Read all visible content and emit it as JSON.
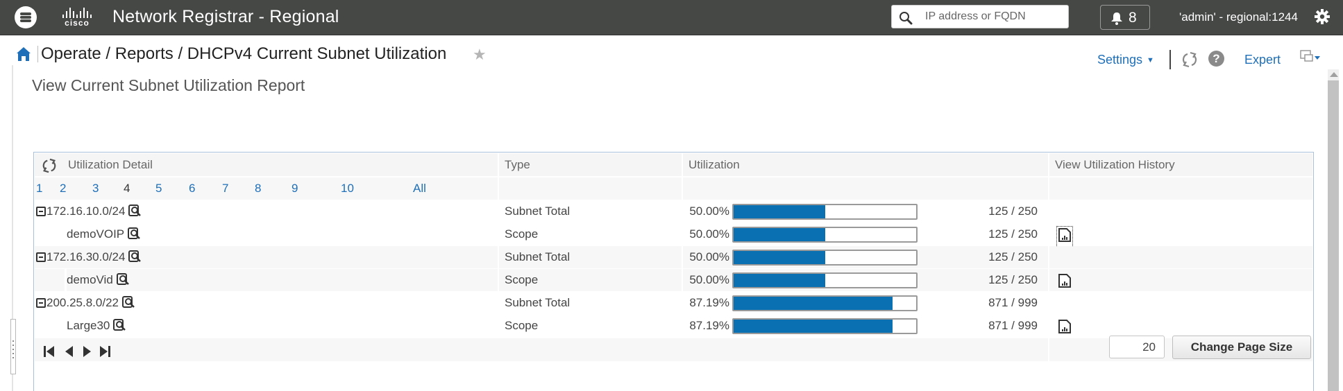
{
  "header": {
    "brand": "cisco",
    "app_title": "Network Registrar - Regional",
    "search_placeholder": "IP address or FQDN",
    "notifications_count": "8",
    "user_label": "'admin' - regional:1244"
  },
  "breadcrumb": {
    "path": [
      "Operate",
      "Reports",
      "DHCPv4 Current Subnet Utilization"
    ],
    "separator": " / "
  },
  "toolbar": {
    "settings_label": "Settings",
    "expert_label": "Expert",
    "help_label": "?"
  },
  "page": {
    "title": "View Current Subnet Utilization Report"
  },
  "table": {
    "columns": [
      "Utilization Detail",
      "Type",
      "Utilization",
      "View Utilization History"
    ],
    "pages": [
      "1",
      "2",
      "3",
      "4",
      "5",
      "6",
      "7",
      "8",
      "9",
      "10",
      "All"
    ],
    "current_page": "4",
    "rows": [
      {
        "name": "172.16.10.0/24",
        "level": "subnet",
        "type": "Subnet Total",
        "percent_label": "50.00%",
        "percent": 50.0,
        "count": "125 / 250",
        "history": false
      },
      {
        "name": "demoVOIP",
        "level": "scope",
        "type": "Scope",
        "percent_label": "50.00%",
        "percent": 50.0,
        "count": "125 / 250",
        "history": true,
        "focused": true
      },
      {
        "name": "172.16.30.0/24",
        "level": "subnet",
        "type": "Subnet Total",
        "percent_label": "50.00%",
        "percent": 50.0,
        "count": "125 / 250",
        "history": false
      },
      {
        "name": "demoVid",
        "level": "scope",
        "type": "Scope",
        "percent_label": "50.00%",
        "percent": 50.0,
        "count": "125 / 250",
        "history": true
      },
      {
        "name": "200.25.8.0/22",
        "level": "subnet",
        "type": "Subnet Total",
        "percent_label": "87.19%",
        "percent": 87.19,
        "count": "871 / 999",
        "history": false
      },
      {
        "name": "Large30",
        "level": "scope",
        "type": "Scope",
        "percent_label": "87.19%",
        "percent": 87.19,
        "count": "871 / 999",
        "history": true
      }
    ],
    "page_size": "20",
    "change_page_size_label": "Change Page Size"
  },
  "colors": {
    "header_bg": "#464846",
    "link": "#1e6fb8",
    "bar_fill": "#0a70b2"
  }
}
